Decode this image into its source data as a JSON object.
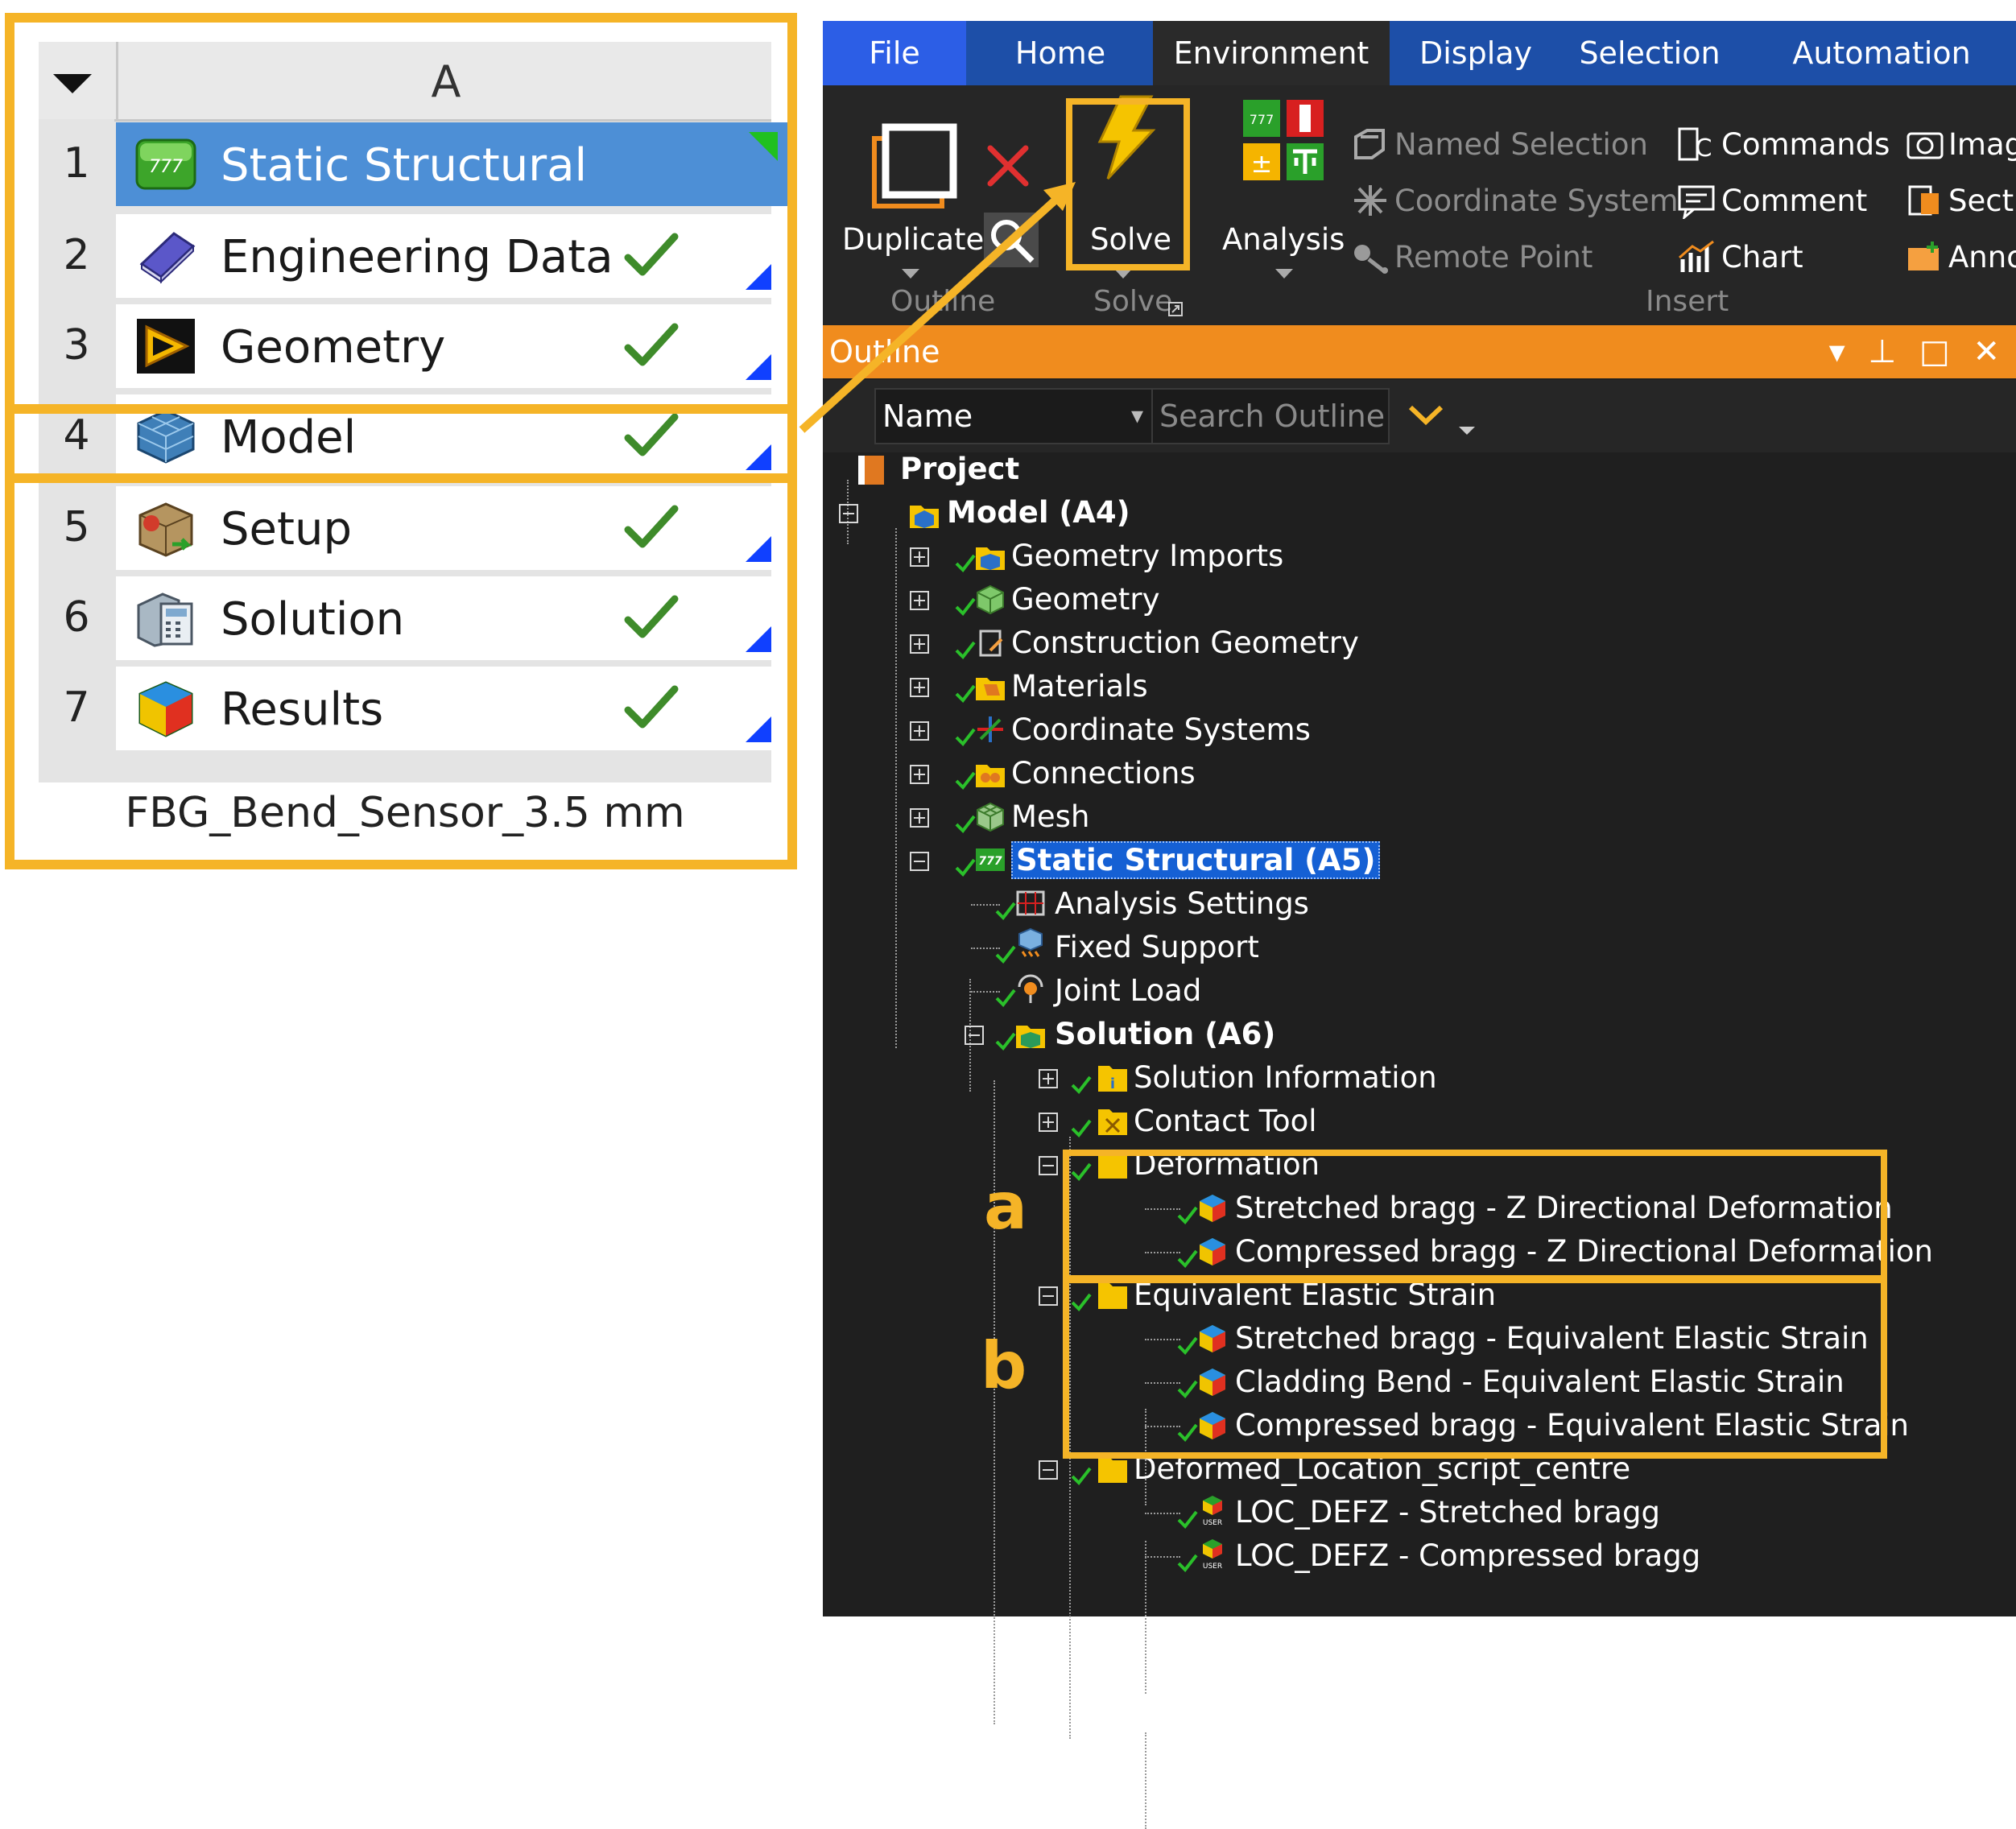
{
  "colors": {
    "highlight": "#f5b427",
    "workbench_selected": "#4d8fd6",
    "menubar": "#1d4fa8",
    "outline_bar": "#f08c1e",
    "tree_selected": "#1560d4"
  },
  "workbench": {
    "column_header": "A",
    "rows": [
      {
        "num": "1",
        "label": "Static Structural",
        "icon": "static-structural-icon",
        "status": ""
      },
      {
        "num": "2",
        "label": "Engineering Data",
        "icon": "engineering-data-icon",
        "status": "check"
      },
      {
        "num": "3",
        "label": "Geometry",
        "icon": "geometry-icon",
        "status": "check"
      },
      {
        "num": "4",
        "label": "Model",
        "icon": "model-icon",
        "status": "check"
      },
      {
        "num": "5",
        "label": "Setup",
        "icon": "setup-icon",
        "status": "check"
      },
      {
        "num": "6",
        "label": "Solution",
        "icon": "solution-icon",
        "status": "check"
      },
      {
        "num": "7",
        "label": "Results",
        "icon": "results-icon",
        "status": "check"
      }
    ],
    "caption": "FBG_Bend_Sensor_3.5 mm"
  },
  "menu": {
    "tabs": [
      "File",
      "Home",
      "Environment",
      "Display",
      "Selection",
      "Automation"
    ]
  },
  "ribbon": {
    "duplicate": "Duplicate",
    "solve": "Solve",
    "analysis": "Analysis",
    "named_selection": "Named Selection",
    "coordinate_system": "Coordinate System",
    "remote_point": "Remote Point",
    "commands": "Commands",
    "comment": "Comment",
    "chart": "Chart",
    "images": "Imag",
    "section": "Secti",
    "annotation": "Anno",
    "group_outline": "Outline",
    "group_solve": "Solve",
    "group_insert": "Insert"
  },
  "outline": {
    "title": "Outline",
    "name_filter": "Name",
    "search_placeholder": "Search Outline"
  },
  "tree": {
    "project": "Project",
    "model": "Model (A4)",
    "geometry_imports": "Geometry Imports",
    "geometry": "Geometry",
    "construction_geometry": "Construction Geometry",
    "materials": "Materials",
    "coordinate_systems": "Coordinate Systems",
    "connections": "Connections",
    "mesh": "Mesh",
    "static_structural": "Static Structural (A5)",
    "analysis_settings": "Analysis Settings",
    "fixed_support": "Fixed Support",
    "joint_load": "Joint Load",
    "solution": "Solution (A6)",
    "solution_information": "Solution Information",
    "contact_tool": "Contact Tool",
    "deformation": "Deformation",
    "stretched_deformation": "Stretched bragg - Z Directional Deformation",
    "compressed_deformation": "Compressed bragg - Z Directional Deformation",
    "equivalent_elastic_strain": "Equivalent Elastic Strain",
    "stretched_strain": "Stretched bragg - Equivalent Elastic Strain",
    "cladding_strain": "Cladding Bend - Equivalent Elastic Strain",
    "compressed_strain": "Compressed bragg - Equivalent Elastic Strain",
    "deformed_location": "Deformed_Location_script_centre",
    "loc_stretched": "LOC_DEFZ - Stretched bragg",
    "loc_compressed": "LOC_DEFZ - Compressed bragg",
    "user_tag": "USER"
  },
  "panel_labels": {
    "a": "a",
    "b": "b"
  }
}
